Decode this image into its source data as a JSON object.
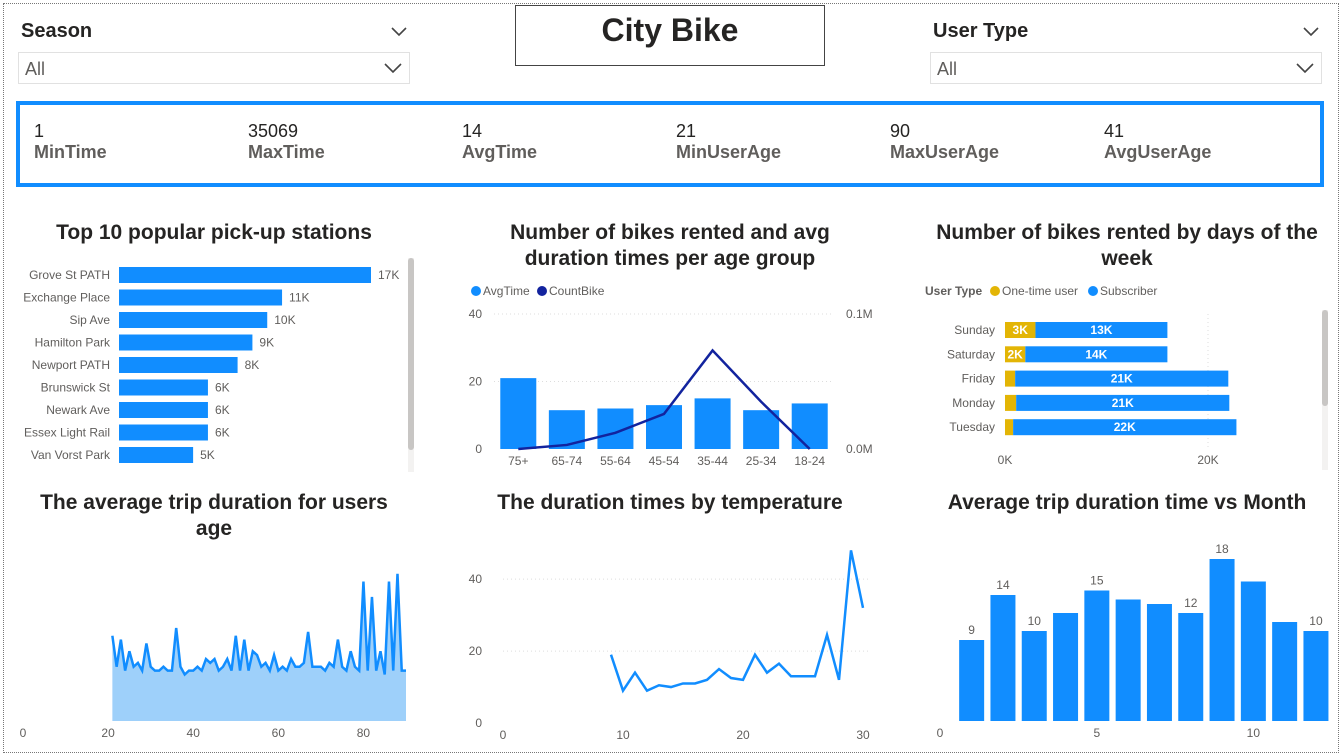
{
  "app": {
    "title": "City Bike"
  },
  "slicers": {
    "season": {
      "label": "Season",
      "value": "All"
    },
    "user_type": {
      "label": "User Type",
      "value": "All"
    }
  },
  "kpis": [
    {
      "value": "1",
      "label": "MinTime"
    },
    {
      "value": "35069",
      "label": "MaxTime"
    },
    {
      "value": "14",
      "label": "AvgTime"
    },
    {
      "value": "21",
      "label": "MinUserAge"
    },
    {
      "value": "90",
      "label": "MaxUserAge"
    },
    {
      "value": "41",
      "label": "AvgUserAge"
    }
  ],
  "charts": {
    "stations": {
      "title": "Top 10 popular pick-up stations"
    },
    "age_group": {
      "title_line1": "Number of bikes rented and avg",
      "title_line2": "duration times per age group"
    },
    "days": {
      "title_line1": "Number of bikes rented by days of the",
      "title_line2": "week"
    },
    "age_duration": {
      "title_line1": "The average trip duration for users",
      "title_line2": "age"
    },
    "temperature": {
      "title": "The duration times by temperature"
    },
    "month": {
      "title": "Average trip duration time vs Month"
    }
  },
  "colors": {
    "accent": "#118dff",
    "dark": "#12239e",
    "gold": "#e3b505",
    "area": "#9ed0fa"
  },
  "chart_data": [
    {
      "id": "stations",
      "type": "bar",
      "orientation": "horizontal",
      "categories": [
        "Grove St PATH",
        "Exchange Place",
        "Sip Ave",
        "Hamilton Park",
        "Newport PATH",
        "Brunswick St",
        "Newark Ave",
        "Essex Light Rail",
        "Van Vorst Park"
      ],
      "values": [
        17000,
        11000,
        10000,
        9000,
        8000,
        6000,
        6000,
        6000,
        5000
      ],
      "labels": [
        "17K",
        "11K",
        "10K",
        "9K",
        "8K",
        "6K",
        "6K",
        "6K",
        "5K"
      ],
      "title": "Top 10 popular pick-up stations"
    },
    {
      "id": "age_group",
      "type": "bar",
      "categories": [
        "75+",
        "65-74",
        "55-64",
        "45-54",
        "35-44",
        "25-34",
        "18-24"
      ],
      "series": [
        {
          "name": "AvgTime",
          "kind": "bar",
          "axis": "left",
          "values": [
            21,
            11.5,
            12,
            13,
            15,
            11.5,
            13.5
          ]
        },
        {
          "name": "CountBike",
          "kind": "line",
          "axis": "right",
          "values": [
            0,
            0.003,
            0.012,
            0.026,
            0.073,
            0.035,
            0
          ]
        }
      ],
      "yticks_left": [
        "0",
        "20",
        "40"
      ],
      "yticks_right": [
        "0.0M",
        "0.1M"
      ],
      "ylim_left": [
        0,
        40
      ],
      "ylim_right": [
        0,
        0.1
      ],
      "legend": "top-left"
    },
    {
      "id": "days",
      "type": "bar",
      "orientation": "horizontal",
      "stacked": true,
      "legend_title": "User Type",
      "categories": [
        "Sunday",
        "Saturday",
        "Friday",
        "Monday",
        "Tuesday"
      ],
      "series": [
        {
          "name": "One-time user",
          "values": [
            3000,
            2000,
            1000,
            1100,
            800
          ],
          "labels": [
            "3K",
            "2K",
            "",
            "",
            ""
          ]
        },
        {
          "name": "Subscriber",
          "values": [
            13000,
            14000,
            21000,
            21000,
            22000
          ],
          "labels": [
            "13K",
            "14K",
            "21K",
            "21K",
            "22K"
          ]
        }
      ],
      "xticks": [
        "0K",
        "20K"
      ],
      "xlim": [
        0,
        23000
      ]
    },
    {
      "id": "age_duration",
      "type": "area",
      "x": [
        21,
        22,
        23,
        24,
        25,
        26,
        27,
        28,
        29,
        30,
        31,
        32,
        33,
        34,
        35,
        36,
        37,
        38,
        39,
        40,
        41,
        42,
        43,
        44,
        45,
        46,
        47,
        48,
        49,
        50,
        51,
        52,
        53,
        54,
        55,
        56,
        57,
        58,
        59,
        60,
        61,
        62,
        63,
        64,
        65,
        66,
        67,
        68,
        69,
        70,
        71,
        72,
        73,
        74,
        75,
        76,
        77,
        78,
        79,
        80,
        81,
        82,
        83,
        84,
        85,
        86,
        87,
        88,
        89,
        90
      ],
      "y": [
        22,
        14,
        21,
        13,
        18,
        14,
        15,
        13,
        20,
        14,
        13,
        13,
        14,
        13,
        13,
        24,
        14,
        12,
        13,
        13,
        14,
        13,
        16,
        15,
        16,
        13,
        14,
        16,
        13,
        22,
        13,
        21,
        13,
        18,
        17,
        14,
        15,
        13,
        17,
        13,
        14,
        13,
        16,
        14,
        14,
        15,
        23,
        14,
        14,
        14,
        13,
        15,
        14,
        21,
        14,
        13,
        18,
        14,
        13,
        36,
        13,
        32,
        13,
        18,
        12,
        36,
        13,
        38,
        13,
        13
      ],
      "xticks": [
        "0",
        "20",
        "40",
        "60",
        "80"
      ],
      "xlim": [
        0,
        90
      ]
    },
    {
      "id": "temperature",
      "type": "line",
      "x": [
        9,
        10,
        11,
        12,
        13,
        14,
        15,
        16,
        17,
        18,
        19,
        20,
        21,
        22,
        23,
        24,
        25,
        26,
        27,
        28,
        29,
        30
      ],
      "y": [
        19,
        9,
        14,
        9,
        10.5,
        10,
        11,
        11,
        12,
        15,
        12.5,
        12,
        19,
        14,
        16.5,
        13,
        13,
        13,
        24.5,
        12,
        48,
        32
      ],
      "xticks": [
        "0",
        "10",
        "20",
        "30"
      ],
      "yticks": [
        "0",
        "20",
        "40"
      ],
      "xlim": [
        0,
        30
      ],
      "ylim": [
        0,
        52
      ]
    },
    {
      "id": "month",
      "type": "bar",
      "categories": [
        "1",
        "2",
        "3",
        "4",
        "5",
        "6",
        "7",
        "8",
        "9",
        "10",
        "11",
        "12"
      ],
      "values": [
        9,
        14,
        10,
        12,
        14.5,
        13.5,
        13,
        12,
        18,
        15.5,
        11,
        10
      ],
      "data_labels": [
        "9",
        "14",
        "10",
        "",
        "15",
        "",
        "",
        "12",
        "18",
        "",
        "",
        "10"
      ],
      "xticks": [
        "0",
        "5",
        "10"
      ],
      "ylim": [
        0,
        20
      ]
    }
  ]
}
